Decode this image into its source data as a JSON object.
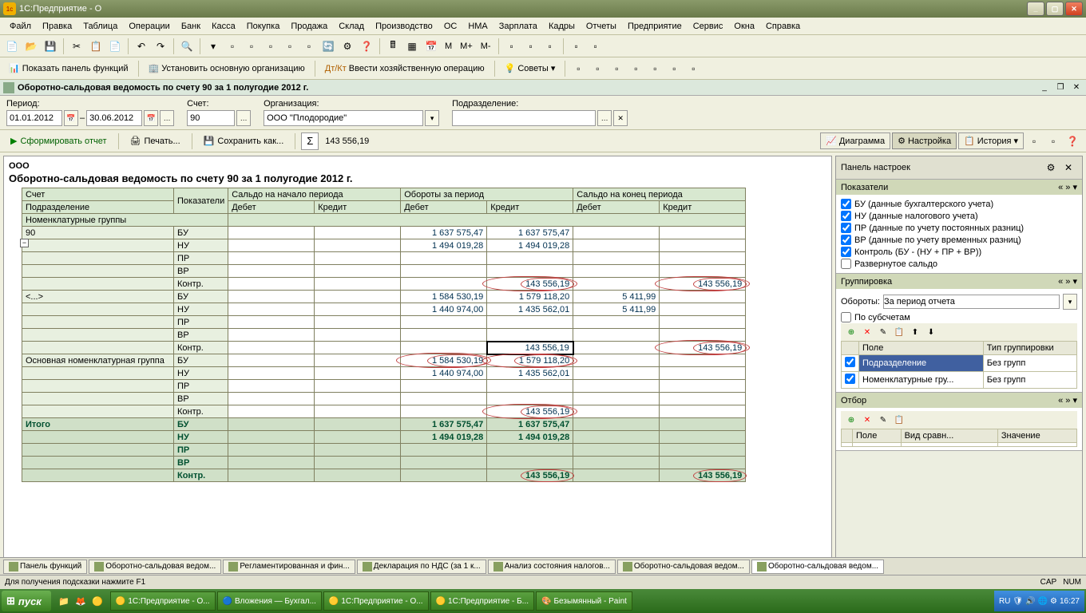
{
  "window": {
    "title": "1С:Предприятие - О"
  },
  "menu": [
    "Файл",
    "Правка",
    "Таблица",
    "Операции",
    "Банк",
    "Касса",
    "Покупка",
    "Продажа",
    "Склад",
    "Производство",
    "ОС",
    "НМА",
    "Зарплата",
    "Кадры",
    "Отчеты",
    "Предприятие",
    "Сервис",
    "Окна",
    "Справка"
  ],
  "toolbar2": {
    "panel_func": "Показать панель функций",
    "set_org": "Установить основную организацию",
    "enter_op": "Ввести хозяйственную операцию",
    "tips": "Советы"
  },
  "subtitle": "Оборотно-сальдовая ведомость по счету 90 за 1 полугодие 2012 г.",
  "params": {
    "period_lbl": "Период:",
    "date_from": "01.01.2012",
    "date_to": "30.06.2012",
    "account_lbl": "Счет:",
    "account": "90",
    "org_lbl": "Организация:",
    "org": "ООО \"Плодородие\"",
    "dept_lbl": "Подразделение:"
  },
  "actions": {
    "form": "Сформировать отчет",
    "print": "Печать...",
    "save": "Сохранить как...",
    "sum": "143 556,19",
    "diagram": "Диаграмма",
    "settings": "Настройка",
    "history": "История"
  },
  "report": {
    "org": "ООО",
    "title": "Оборотно-сальдовая ведомость по счету 90 за 1 полугодие 2012 г.",
    "hdr": {
      "account": "Счет",
      "indicators": "Показатели",
      "start": "Сальдо на начало периода",
      "turnover": "Обороты за период",
      "end": "Сальдо на конец периода",
      "debit": "Дебет",
      "credit": "Кредит",
      "dept": "Подразделение",
      "nomgroup": "Номенклатурные группы"
    },
    "rows": [
      {
        "label": "90",
        "ind": "БУ",
        "td": "1 637 575,47",
        "tc": "1 637 575,47"
      },
      {
        "label": "",
        "ind": "НУ",
        "td": "1 494 019,28",
        "tc": "1 494 019,28"
      },
      {
        "label": "",
        "ind": "ПР"
      },
      {
        "label": "",
        "ind": "ВР"
      },
      {
        "label": "",
        "ind": "Контр.",
        "tc": "143 556,19",
        "tc_c": true,
        "ec": "143 556,19",
        "ec_c": true
      },
      {
        "label": "<...>",
        "ind": "БУ",
        "td": "1 584 530,19",
        "tc": "1 579 118,20",
        "ed": "5 411,99"
      },
      {
        "label": "",
        "ind": "НУ",
        "td": "1 440 974,00",
        "tc": "1 435 562,01",
        "ed": "5 411,99"
      },
      {
        "label": "",
        "ind": "ПР"
      },
      {
        "label": "",
        "ind": "ВР"
      },
      {
        "label": "",
        "ind": "Контр.",
        "tc": "143 556,19",
        "tc_sel": true,
        "ec": "143 556,19",
        "ec_c": true
      },
      {
        "label": "Основная номенклатурная группа",
        "ind": "БУ",
        "td": "1 584 530,19",
        "td_c": true,
        "tc": "1 579 118,20",
        "tc_c": true
      },
      {
        "label": "",
        "ind": "НУ",
        "td": "1 440 974,00",
        "tc": "1 435 562,01"
      },
      {
        "label": "",
        "ind": "ПР"
      },
      {
        "label": "",
        "ind": "ВР"
      },
      {
        "label": "",
        "ind": "Контр.",
        "tc": "143 556,19",
        "tc_c": true
      }
    ],
    "total": {
      "label": "Итого",
      "rows": [
        {
          "ind": "БУ",
          "td": "1 637 575,47",
          "tc": "1 637 575,47"
        },
        {
          "ind": "НУ",
          "td": "1 494 019,28",
          "tc": "1 494 019,28"
        },
        {
          "ind": "ПР"
        },
        {
          "ind": "ВР"
        },
        {
          "ind": "Контр.",
          "tc": "143 556,19",
          "tc_c": true,
          "ec": "143 556,19",
          "ec_c": true
        }
      ]
    }
  },
  "sidepanel": {
    "title": "Панель настроек",
    "indicators_hdr": "Показатели",
    "checks": [
      {
        "l": "БУ (данные бухгалтерского учета)",
        "c": true
      },
      {
        "l": "НУ (данные налогового учета)",
        "c": true
      },
      {
        "l": "ПР (данные по учету постоянных разниц)",
        "c": true
      },
      {
        "l": "ВР (данные по учету временных разниц)",
        "c": true
      },
      {
        "l": "Контроль (БУ - (НУ + ПР + ВР))",
        "c": true
      },
      {
        "l": "Развернутое сальдо",
        "c": false
      }
    ],
    "grouping_hdr": "Группировка",
    "turnover_lbl": "Обороты:",
    "turnover_val": "За период отчета",
    "by_subacct": "По субсчетам",
    "grp_cols": [
      "Поле",
      "Тип группировки"
    ],
    "grp_rows": [
      {
        "c": true,
        "f": "Подразделение",
        "t": "Без групп"
      },
      {
        "c": true,
        "f": "Номенклатурные гру...",
        "t": "Без групп"
      }
    ],
    "filter_hdr": "Отбор",
    "filter_cols": [
      "Поле",
      "Вид сравн...",
      "Значение"
    ]
  },
  "tabs": [
    "Панель функций",
    "Оборотно-сальдовая ведом...",
    "Регламентированная и фин...",
    "Декларация по НДС (за 1 к...",
    "Анализ состояния налогов...",
    "Оборотно-сальдовая ведом...",
    "Оборотно-сальдовая ведом..."
  ],
  "status": {
    "hint": "Для получения подсказки нажмите F1",
    "cap": "CAP",
    "num": "NUM"
  },
  "taskbar": {
    "start": "пуск",
    "tasks": [
      "1С:Предприятие - О...",
      "Вложения — Бухгал...",
      "1С:Предприятие - О...",
      "1С:Предприятие - Б...",
      "Безымянный - Paint"
    ],
    "lang": "RU",
    "time": "16:27"
  }
}
